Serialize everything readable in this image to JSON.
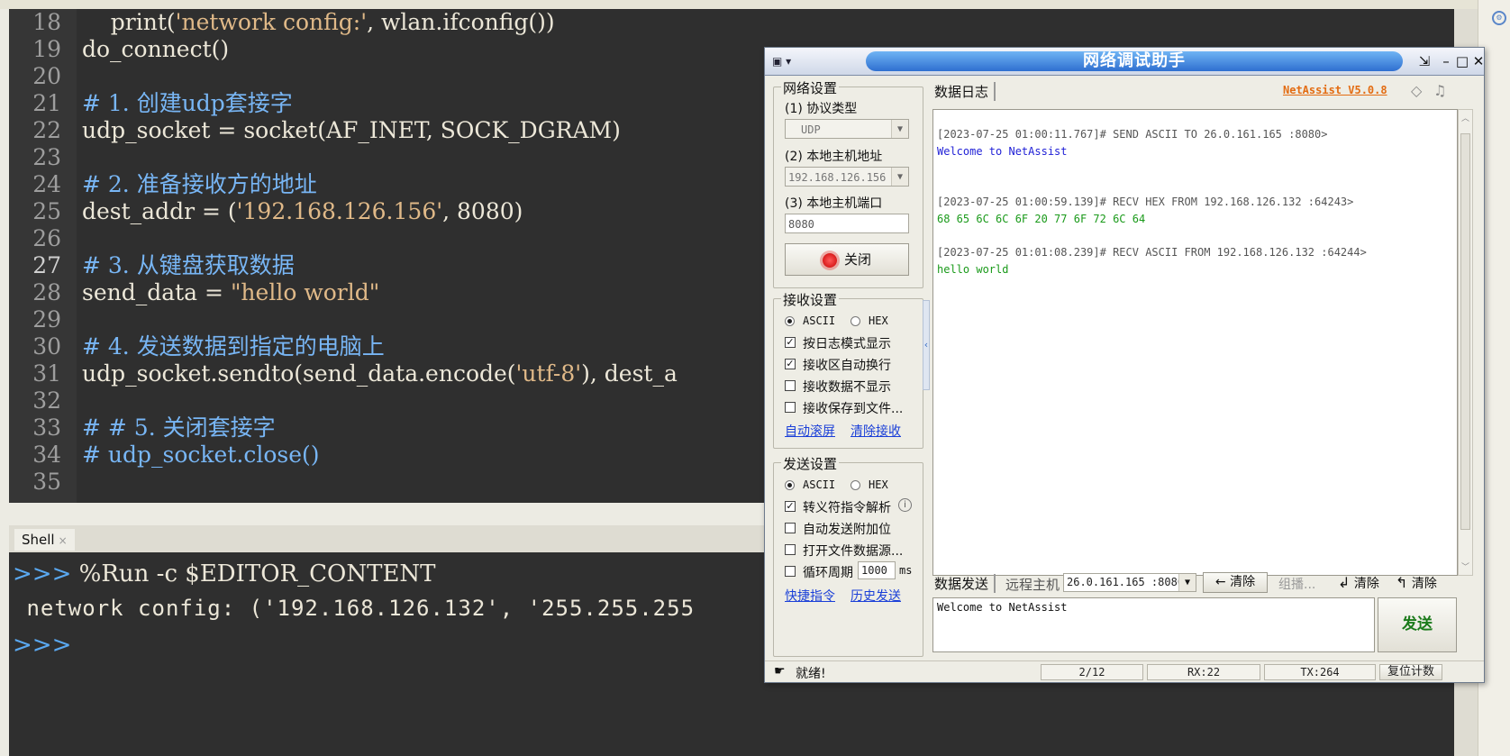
{
  "editor": {
    "lines": [
      {
        "num": "18",
        "parts": [
          [
            "code",
            "    print("
          ],
          [
            "str",
            "'network config:'"
          ],
          [
            "code",
            ", wlan.ifconfig())"
          ]
        ]
      },
      {
        "num": "19",
        "parts": [
          [
            "code",
            "do_connect()"
          ]
        ]
      },
      {
        "num": "20",
        "parts": []
      },
      {
        "num": "21",
        "parts": [
          [
            "comment",
            "# 1. 创建udp套接字"
          ]
        ]
      },
      {
        "num": "22",
        "parts": [
          [
            "code",
            "udp_socket = socket(AF_INET, SOCK_DGRAM)"
          ]
        ]
      },
      {
        "num": "23",
        "parts": []
      },
      {
        "num": "24",
        "parts": [
          [
            "comment",
            "# 2. 准备接收方的地址"
          ]
        ]
      },
      {
        "num": "25",
        "parts": [
          [
            "code",
            "dest_addr = ("
          ],
          [
            "str",
            "'192.168.126.156'"
          ],
          [
            "code",
            ", 8080)"
          ]
        ]
      },
      {
        "num": "26",
        "parts": []
      },
      {
        "num": "27",
        "parts": [
          [
            "comment",
            "# 3. 从键盘获取数据"
          ]
        ]
      },
      {
        "num": "28",
        "parts": [
          [
            "code",
            "send_data = "
          ],
          [
            "str",
            "\"hello world\""
          ]
        ]
      },
      {
        "num": "29",
        "parts": []
      },
      {
        "num": "30",
        "parts": [
          [
            "comment",
            "# 4. 发送数据到指定的电脑上"
          ]
        ]
      },
      {
        "num": "31",
        "parts": [
          [
            "code",
            "udp_socket.sendto(send_data.encode("
          ],
          [
            "str",
            "'utf-8'"
          ],
          [
            "code",
            "), dest_a"
          ]
        ]
      },
      {
        "num": "32",
        "parts": []
      },
      {
        "num": "33",
        "parts": [
          [
            "comment",
            "# # 5. 关闭套接字"
          ]
        ]
      },
      {
        "num": "34",
        "parts": [
          [
            "comment",
            "# udp_socket.close()"
          ]
        ]
      },
      {
        "num": "35",
        "parts": []
      }
    ],
    "current_line": "27"
  },
  "shell": {
    "tab_label": "Shell",
    "tab_close": "×",
    "prompt": ">>>",
    "command": " %Run -c $EDITOR_CONTENT",
    "output": " network config: ('192.168.126.132', '255.255.255",
    "prompt2": ">>>"
  },
  "netassist": {
    "title": "网络调试助手",
    "brand": "NetAssist V5.0.8",
    "net_settings": {
      "label": "网络设置",
      "protocol_label": "(1) 协议类型",
      "protocol_value": "UDP",
      "host_label": "(2) 本地主机地址",
      "host_value": "192.168.126.156",
      "port_label": "(3) 本地主机端口",
      "port_value": "8080",
      "close_button": "关闭"
    },
    "recv_settings": {
      "label": "接收设置",
      "ascii": "ASCII",
      "hex": "HEX",
      "checks": [
        {
          "label": "按日志模式显示",
          "checked": true
        },
        {
          "label": "接收区自动换行",
          "checked": true
        },
        {
          "label": "接收数据不显示",
          "checked": false
        },
        {
          "label": "接收保存到文件...",
          "checked": false
        }
      ],
      "link_autoscroll": "自动滚屏",
      "link_clear": "清除接收"
    },
    "send_settings": {
      "label": "发送设置",
      "ascii": "ASCII",
      "hex": "HEX",
      "checks": [
        {
          "label": "转义符指令解析",
          "checked": true
        },
        {
          "label": "自动发送附加位",
          "checked": false
        },
        {
          "label": "打开文件数据源...",
          "checked": false
        },
        {
          "label": "循环周期",
          "checked": false
        }
      ],
      "period_value": "1000",
      "period_unit": "ms",
      "link_shortcut": "快捷指令",
      "link_history": "历史发送"
    },
    "log_tab": "数据日志",
    "log": [
      {
        "text": "[2023-07-25 01:00:11.767]# SEND ASCII TO 26.0.161.165 :8080>",
        "color": "#555555"
      },
      {
        "text": "Welcome to NetAssist",
        "color": "#1f1fd6"
      },
      {
        "text": "[2023-07-25 01:00:59.139]# RECV HEX FROM 192.168.126.132 :64243>",
        "color": "#555555"
      },
      {
        "text": "68 65 6C 6C 6F 20 77 6F 72 6C 64",
        "color": "#1a9a1a"
      },
      {
        "text": "[2023-07-25 01:01:08.239]# RECV ASCII FROM 192.168.126.132 :64244>",
        "color": "#555555"
      },
      {
        "text": "hello world",
        "color": "#1a9a1a"
      }
    ],
    "send_bar": {
      "tab": "数据发送",
      "remote_label": "远程主机",
      "remote_value": "26.0.161.165 :8080",
      "clear1": "清除",
      "group": "组播...",
      "clear2": "清除",
      "clear3": "清除"
    },
    "send_text": "Welcome to NetAssist",
    "send_button": "发送",
    "status": {
      "ready": "就绪!",
      "count": "2/12",
      "rx": "RX:22",
      "tx": "TX:264",
      "reset": "复位计数"
    }
  }
}
